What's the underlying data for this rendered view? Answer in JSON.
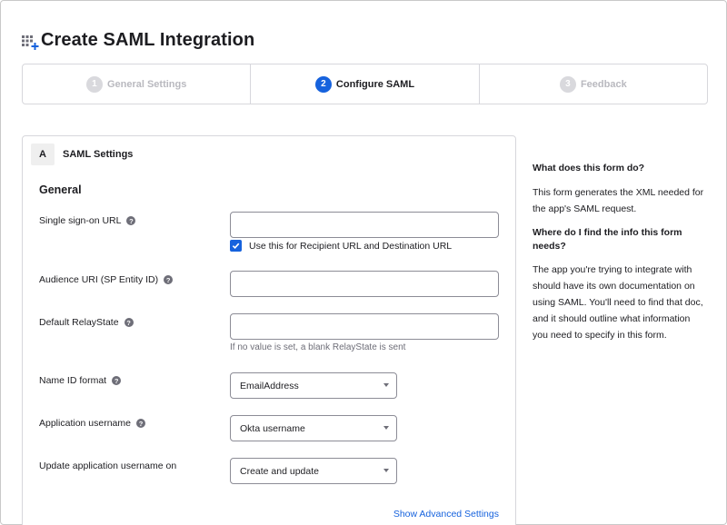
{
  "page": {
    "title": "Create SAML Integration",
    "icon": "app-grid-add-icon"
  },
  "stepper": {
    "steps": [
      {
        "num": "1",
        "label": "General Settings",
        "state": "inactive"
      },
      {
        "num": "2",
        "label": "Configure SAML",
        "state": "active"
      },
      {
        "num": "3",
        "label": "Feedback",
        "state": "inactive"
      }
    ]
  },
  "saml_panel": {
    "badge": "A",
    "title": "SAML Settings",
    "section": "General",
    "sso_url": {
      "label": "Single sign-on URL",
      "value": "",
      "placeholder": ""
    },
    "recipient_checkbox": {
      "label": "Use this for Recipient URL and Destination URL",
      "checked": true
    },
    "audience_uri": {
      "label": "Audience URI (SP Entity ID)",
      "value": "",
      "placeholder": ""
    },
    "relay_state": {
      "label": "Default RelayState",
      "value": "",
      "placeholder": "",
      "hint": "If no value is set, a blank RelayState is sent"
    },
    "name_id_format": {
      "label": "Name ID format",
      "selected": "EmailAddress"
    },
    "app_username": {
      "label": "Application username",
      "selected": "Okta username"
    },
    "update_username": {
      "label": "Update application username on",
      "selected": "Create and update"
    },
    "advanced_link": "Show Advanced Settings",
    "help_glyph": "?"
  },
  "help_sidebar": {
    "q1": "What does this form do?",
    "a1": "This form generates the XML needed for the app's SAML request.",
    "q2": "Where do I find the info this form needs?",
    "a2": "The app you're trying to integrate with should have its own documentation on using SAML. You'll need to find that doc, and it should outline what information you need to specify in this form."
  },
  "colors": {
    "accent": "#1662dd",
    "text": "#1d1d21",
    "muted": "#6e6e78",
    "border": "#d7d7dc"
  }
}
